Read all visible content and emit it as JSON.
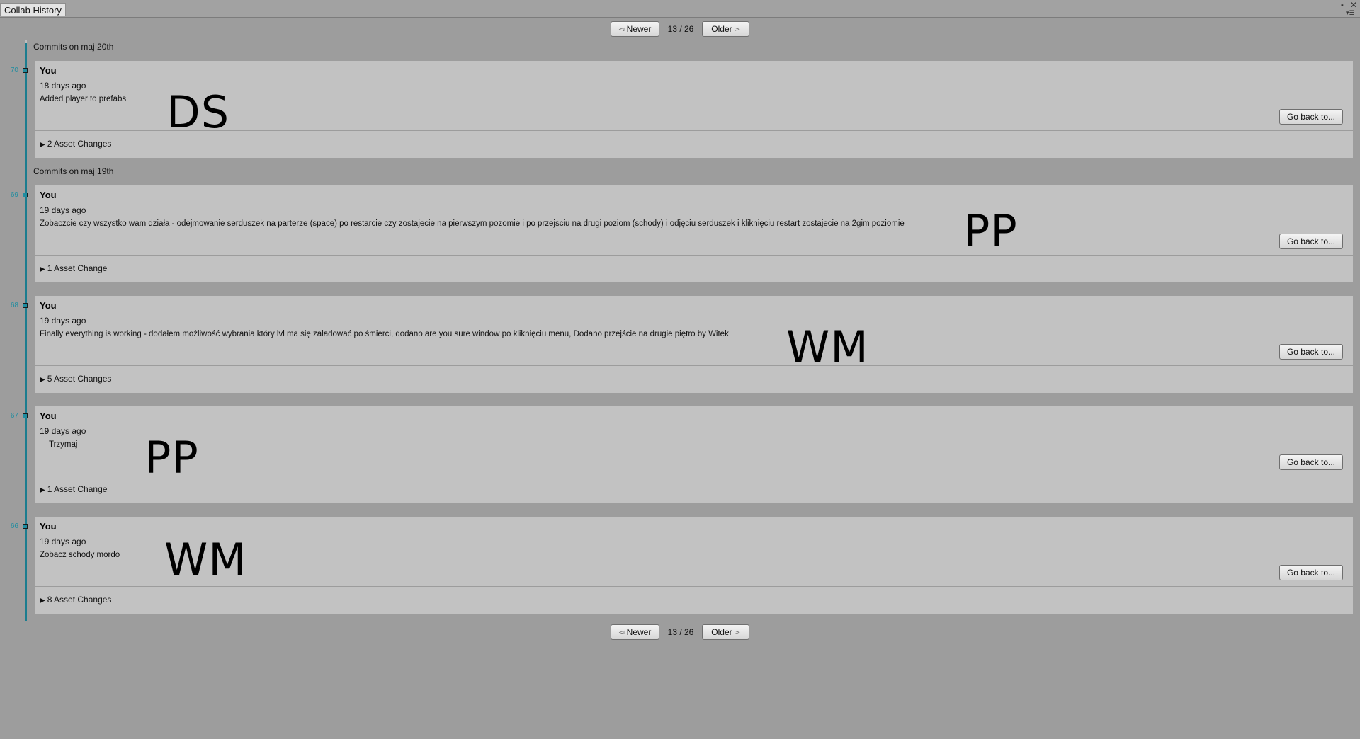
{
  "window": {
    "tab_title": "Collab History"
  },
  "pagination": {
    "newer_label": "Newer",
    "older_label": "Older",
    "page_text": "13 / 26"
  },
  "groups": [
    {
      "header": "Commits on maj 20th"
    },
    {
      "header": "Commits on maj 19th"
    }
  ],
  "commits": [
    {
      "number": "70",
      "author": "You",
      "time": "18 days ago",
      "message": "Added player to prefabs",
      "asset_changes": "2 Asset Changes",
      "go_back_label": "Go back to...",
      "annotation": "DS"
    },
    {
      "number": "69",
      "author": "You",
      "time": "19 days ago",
      "message": "Zobaczcie czy wszystko wam działa - odejmowanie serduszek na parterze (space) po restarcie czy zostajecie na pierwszym pozomie i po przejsciu na drugi poziom (schody) i odjęciu serduszek i kliknięciu restart zostajecie na 2gim poziomie",
      "asset_changes": "1 Asset Change",
      "go_back_label": "Go back to...",
      "annotation": "PP"
    },
    {
      "number": "68",
      "author": "You",
      "time": "19 days ago",
      "message": "Finally everything is working - dodałem możliwość wybrania który lvl ma się załadować po śmierci, dodano are you sure window po kliknięciu menu, Dodano przejście na drugie piętro by Witek",
      "asset_changes": "5 Asset Changes",
      "go_back_label": "Go back to...",
      "annotation": "WM"
    },
    {
      "number": "67",
      "author": "You",
      "time": "19 days ago",
      "message": "Trzymaj",
      "asset_changes": "1 Asset Change",
      "go_back_label": "Go back to...",
      "annotation": "PP"
    },
    {
      "number": "66",
      "author": "You",
      "time": "19 days ago",
      "message": "Zobacz schody mordo",
      "asset_changes": "8 Asset Changes",
      "go_back_label": "Go back to...",
      "annotation": "WM"
    }
  ],
  "icons": {
    "newer": "triangle-left-icon",
    "older": "triangle-right-icon",
    "expand": "triangle-right-icon",
    "maximize": "maximize-icon",
    "close": "close-icon",
    "menu": "menu-icon"
  },
  "colors": {
    "timeline": "#1b7d8f",
    "commit_number": "#1f8da0",
    "background": "#9d9d9d",
    "card": "#c2c2c2"
  }
}
